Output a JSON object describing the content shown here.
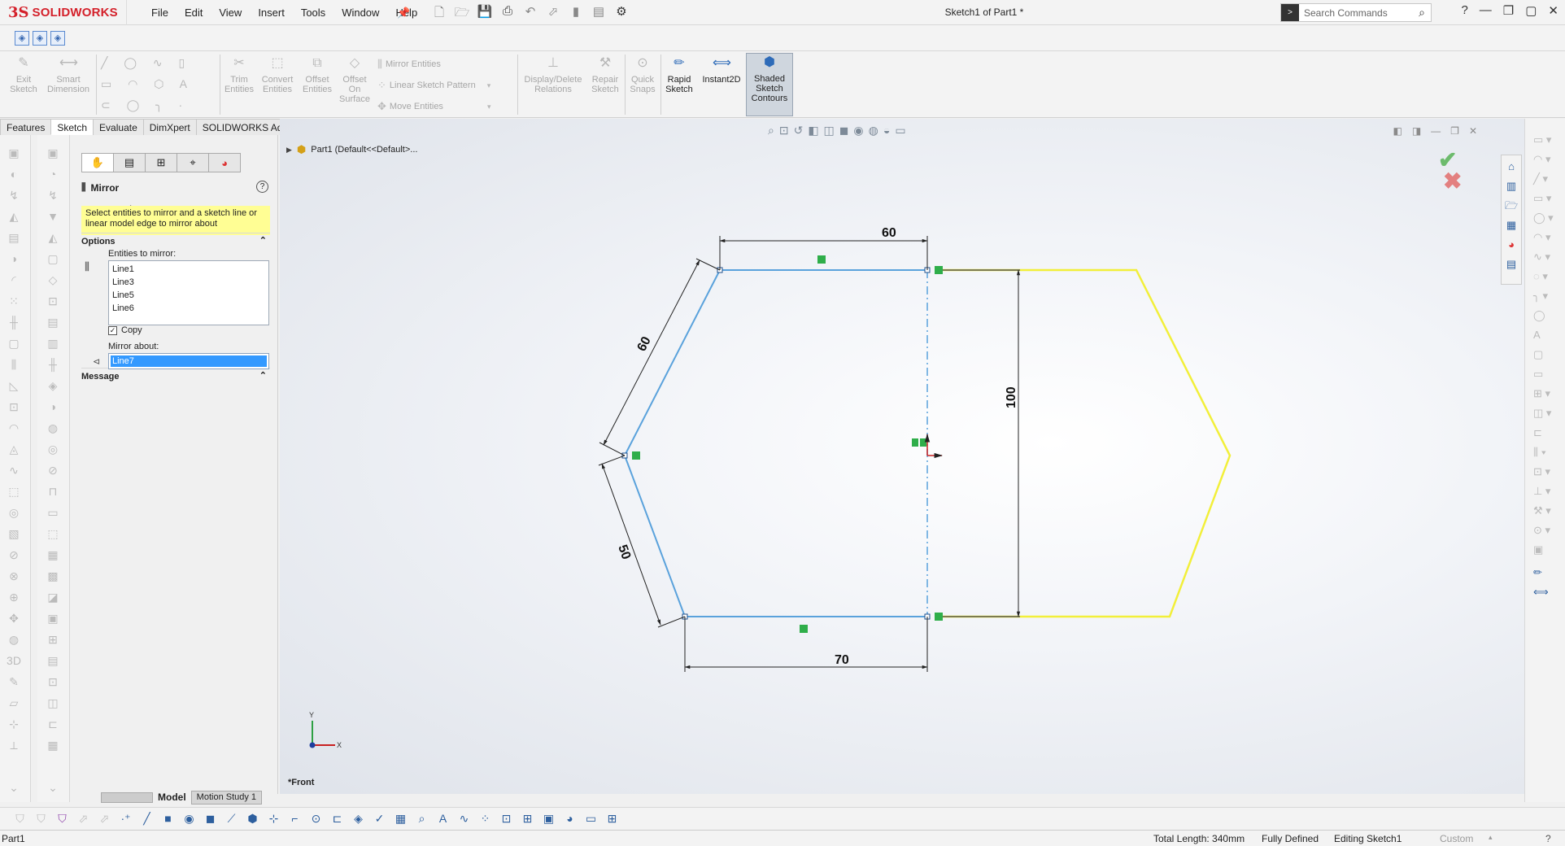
{
  "app": {
    "logo_prefix": "3S",
    "logo_text": "SOLIDWORKS",
    "document_title": "Sketch1 of Part1 *",
    "menu": [
      "File",
      "Edit",
      "View",
      "Insert",
      "Tools",
      "Window",
      "Help"
    ],
    "search_placeholder": "Search Commands"
  },
  "command_manager": {
    "exit_sketch": "Exit Sketch",
    "smart_dimension": "Smart Dimension",
    "trim_entities": "Trim Entities",
    "convert_entities": "Convert Entities",
    "offset_entities": "Offset Entities",
    "offset_on_surface": "Offset On Surface",
    "mirror_entities": "Mirror Entities",
    "linear_sketch_pattern": "Linear Sketch Pattern",
    "move_entities": "Move Entities",
    "display_delete_relations": "Display/Delete Relations",
    "repair_sketch": "Repair Sketch",
    "quick_snaps": "Quick Snaps",
    "rapid_sketch": "Rapid Sketch",
    "instant2d": "Instant2D",
    "shaded_sketch_contours": "Shaded Sketch Contours"
  },
  "tabs": [
    "Features",
    "Sketch",
    "Evaluate",
    "DimXpert",
    "SOLIDWORKS Add-Ins"
  ],
  "active_tab": "Sketch",
  "property_manager": {
    "title": "Mirror",
    "message_heading": "Message",
    "message": "Select entities to mirror and a sketch line or linear model edge to mirror about",
    "options_heading": "Options",
    "entities_label": "Entities to mirror:",
    "entities": [
      "Line1",
      "Line3",
      "Line5",
      "Line6"
    ],
    "copy_label": "Copy",
    "copy_checked": true,
    "mirror_about_label": "Mirror about:",
    "mirror_about_value": "Line7"
  },
  "graphics": {
    "tree_root": "Part1  (Default<<Default>...",
    "view_label": "*Front",
    "dimensions": {
      "top": "60",
      "upper_left": "60",
      "lower_left": "50",
      "bottom": "70",
      "height": "100"
    },
    "triad": {
      "y": "Y",
      "x": "X"
    }
  },
  "bottom_tabs": {
    "model": "Model",
    "motion_study": "Motion Study 1"
  },
  "status": {
    "part": "Part1",
    "total_length": "Total Length: 340mm",
    "defined": "Fully Defined",
    "editing": "Editing Sketch1",
    "units": "Custom"
  },
  "colors": {
    "sketch_blue": "#5aa2dc",
    "mirror_yellow": "#f2ef3a",
    "message_yellow": "#fffe94",
    "brand_red": "#d4202a"
  }
}
